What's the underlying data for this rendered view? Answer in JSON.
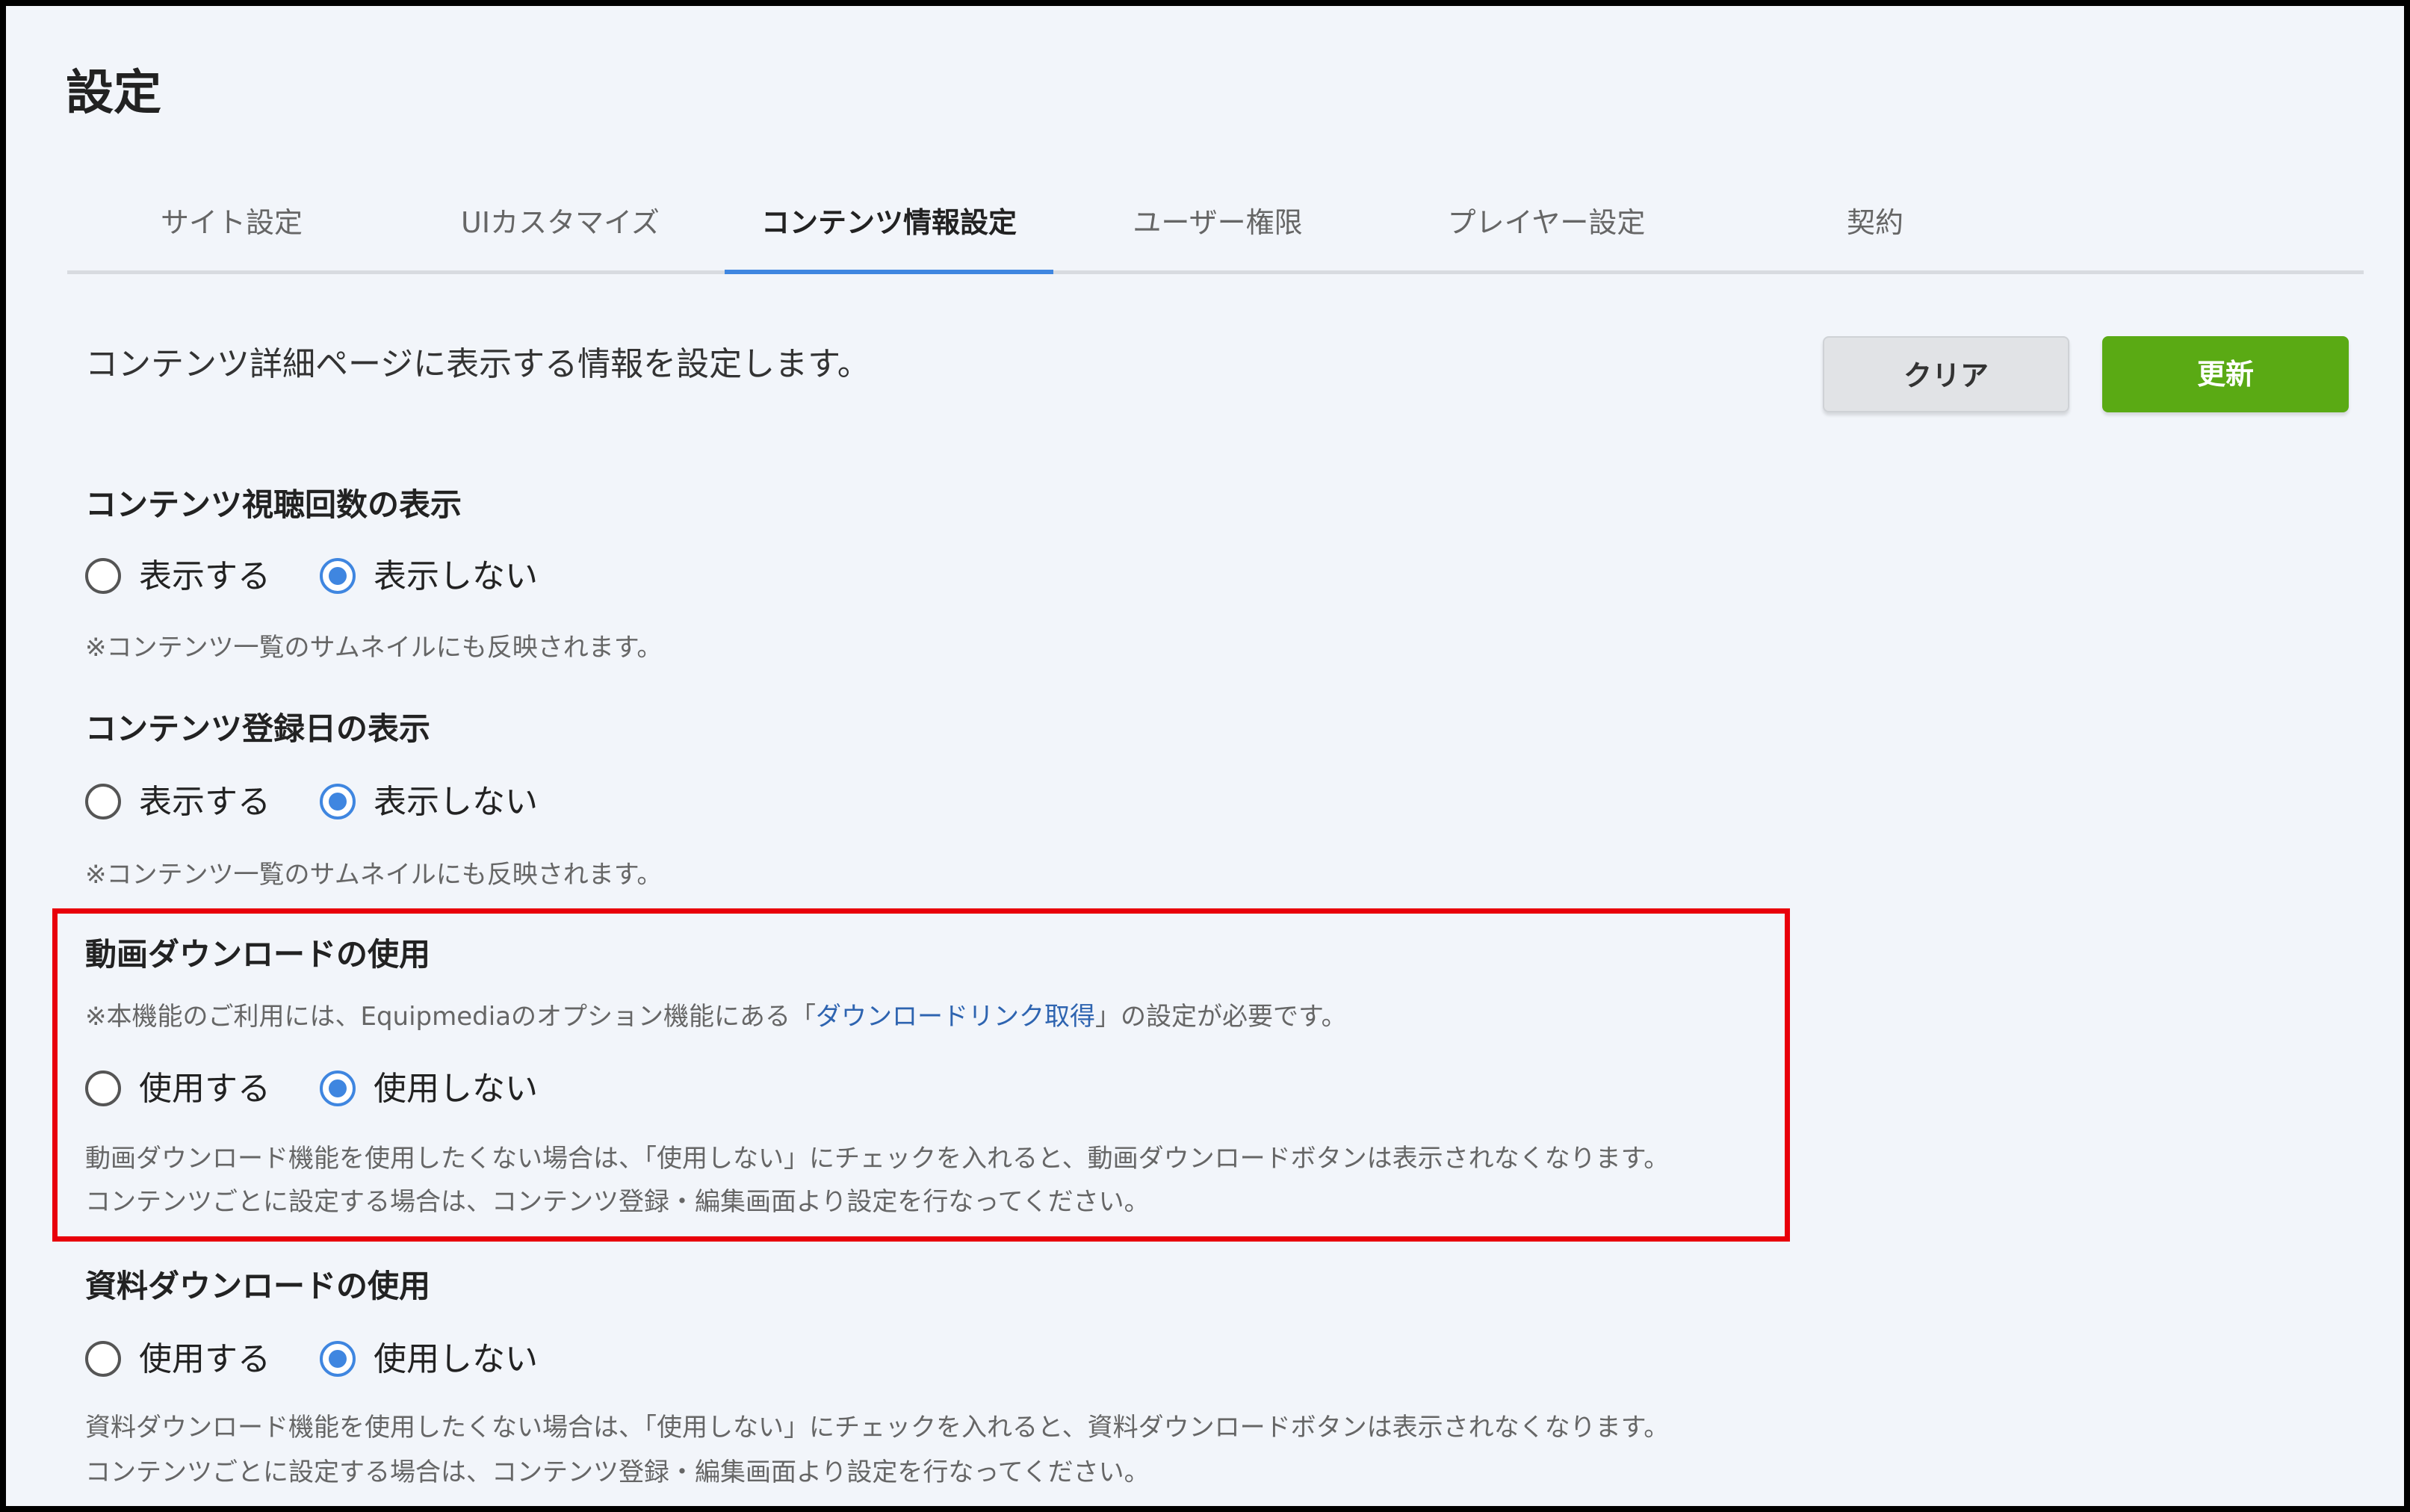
{
  "page": {
    "title": "設定"
  },
  "tabs": [
    {
      "label": "サイト設定",
      "active": false
    },
    {
      "label": "UIカスタマイズ",
      "active": false
    },
    {
      "label": "コンテンツ情報設定",
      "active": true
    },
    {
      "label": "ユーザー権限",
      "active": false
    },
    {
      "label": "プレイヤー設定",
      "active": false
    },
    {
      "label": "契約",
      "active": false
    }
  ],
  "intro": "コンテンツ詳細ページに表示する情報を設定します。",
  "buttons": {
    "clear_label": "クリア",
    "update_label": "更新"
  },
  "colors": {
    "accent": "#3f86e0",
    "update_button": "#5aaa14",
    "highlight_border": "#e8000b",
    "link": "#2e64b0"
  },
  "sections": {
    "view_count": {
      "title": "コンテンツ視聴回数の表示",
      "options": [
        "表示する",
        "表示しない"
      ],
      "selected": "表示しない",
      "note": "※コンテンツ一覧のサムネイルにも反映されます。"
    },
    "registration_date": {
      "title": "コンテンツ登録日の表示",
      "options": [
        "表示する",
        "表示しない"
      ],
      "selected": "表示しない",
      "note": "※コンテンツ一覧のサムネイルにも反映されます。"
    },
    "video_download": {
      "title": "動画ダウンロードの使用",
      "requirement_prefix": "※本機能のご利用には、Equipmediaのオプション機能にある「",
      "requirement_link": "ダウンロードリンク取得",
      "requirement_suffix": "」の設定が必要です。",
      "options": [
        "使用する",
        "使用しない"
      ],
      "selected": "使用しない",
      "note_line1": "動画ダウンロード機能を使用したくない場合は、「使用しない」にチェックを入れると、動画ダウンロードボタンは表示されなくなります。",
      "note_line2": "コンテンツごとに設定する場合は、コンテンツ登録・編集画面より設定を行なってください。"
    },
    "material_download": {
      "title": "資料ダウンロードの使用",
      "options": [
        "使用する",
        "使用しない"
      ],
      "selected": "使用しない",
      "note_line1": "資料ダウンロード機能を使用したくない場合は、「使用しない」にチェックを入れると、資料ダウンロードボタンは表示されなくなります。",
      "note_line2": "コンテンツごとに設定する場合は、コンテンツ登録・編集画面より設定を行なってください。"
    }
  }
}
